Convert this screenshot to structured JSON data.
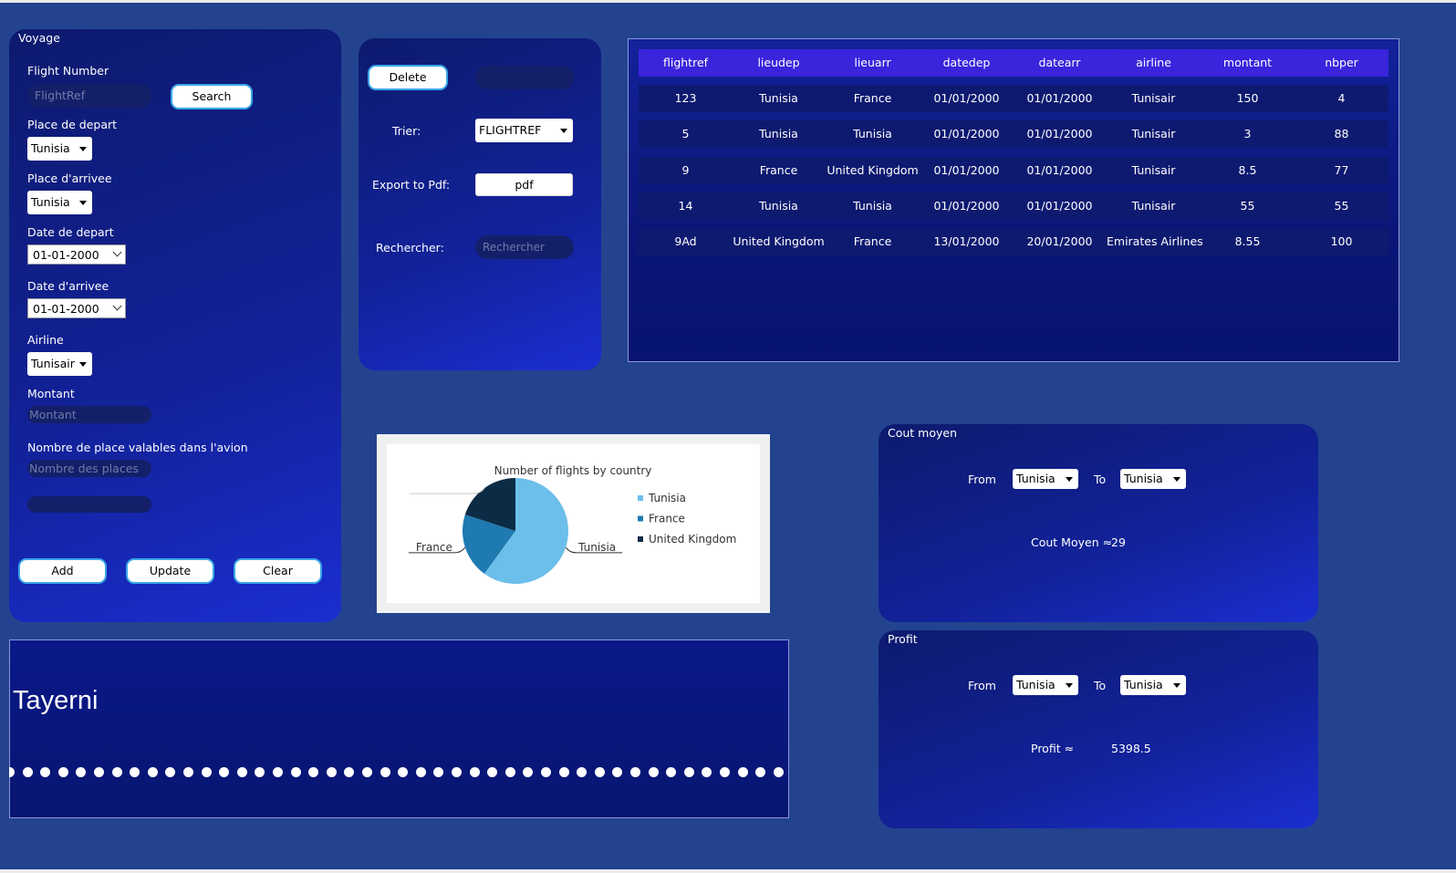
{
  "voyage": {
    "title": "Voyage",
    "flight_number_label": "Flight Number",
    "flight_ref_placeholder": "FlightRef",
    "search_button": "Search",
    "place_depart_label": "Place de depart",
    "place_depart_value": "Tunisia",
    "place_arrivee_label": "Place d'arrivee",
    "place_arrivee_value": "Tunisia",
    "date_depart_label": "Date de depart",
    "date_depart_value": "01-01-2000",
    "date_arrivee_label": "Date d'arrivee",
    "date_arrivee_value": "01-01-2000",
    "airline_label": "Airline",
    "airline_value": "Tunisair",
    "montant_label": "Montant",
    "montant_placeholder": "Montant",
    "nb_places_label": "Nombre de place valables dans l'avion",
    "nb_places_placeholder": "Nombre des places",
    "add_button": "Add",
    "update_button": "Update",
    "clear_button": "Clear"
  },
  "actions": {
    "delete_button": "Delete",
    "trier_label": "Trier:",
    "trier_value": "FLIGHTREF",
    "export_label": "Export to Pdf:",
    "pdf_button": "pdf",
    "rechercher_label": "Rechercher:",
    "rechercher_placeholder": "Rechercher"
  },
  "table": {
    "columns": [
      "flightref",
      "lieudep",
      "lieuarr",
      "datedep",
      "datearr",
      "airline",
      "montant",
      "nbper"
    ],
    "rows": [
      [
        "123",
        "Tunisia",
        "France",
        "01/01/2000",
        "01/01/2000",
        "Tunisair",
        "150",
        "4"
      ],
      [
        "5",
        "Tunisia",
        "Tunisia",
        "01/01/2000",
        "01/01/2000",
        "Tunisair",
        "3",
        "88"
      ],
      [
        "9",
        "France",
        "United Kingdom",
        "01/01/2000",
        "01/01/2000",
        "Tunisair",
        "8.5",
        "77"
      ],
      [
        "14",
        "Tunisia",
        "Tunisia",
        "01/01/2000",
        "01/01/2000",
        "Tunisair",
        "55",
        "55"
      ],
      [
        "9Ad",
        "United Kingdom",
        "France",
        "13/01/2000",
        "20/01/2000",
        "Emirates Airlines",
        "8.55",
        "100"
      ]
    ]
  },
  "chart_data": {
    "type": "pie",
    "title": "Number of flights by country",
    "labels": [
      "Tunisia",
      "France",
      "United Kingdom"
    ],
    "values": [
      3,
      1,
      1
    ],
    "colors": [
      "#6cbfea",
      "#1e7ab0",
      "#0c2b45"
    ],
    "legend_position": "right",
    "slice_labels": [
      "Tunisia",
      "France",
      ""
    ]
  },
  "banner": {
    "title": "Tayerni"
  },
  "cout_moyen": {
    "title": "Cout moyen",
    "from_label": "From",
    "from_value": "Tunisia",
    "to_label": "To",
    "to_value": "Tunisia",
    "result_label": "Cout Moyen ≈",
    "result_value": "29"
  },
  "profit": {
    "title": "Profit",
    "from_label": "From",
    "from_value": "Tunisia",
    "to_label": "To",
    "to_value": "Tunisia",
    "result_label": "Profit ≈",
    "result_value": "5398.5"
  },
  "colors": {
    "background": "#23438f",
    "panel": "#12229a",
    "button_border": "#38a6e8",
    "table_header": "#3a24dc"
  }
}
